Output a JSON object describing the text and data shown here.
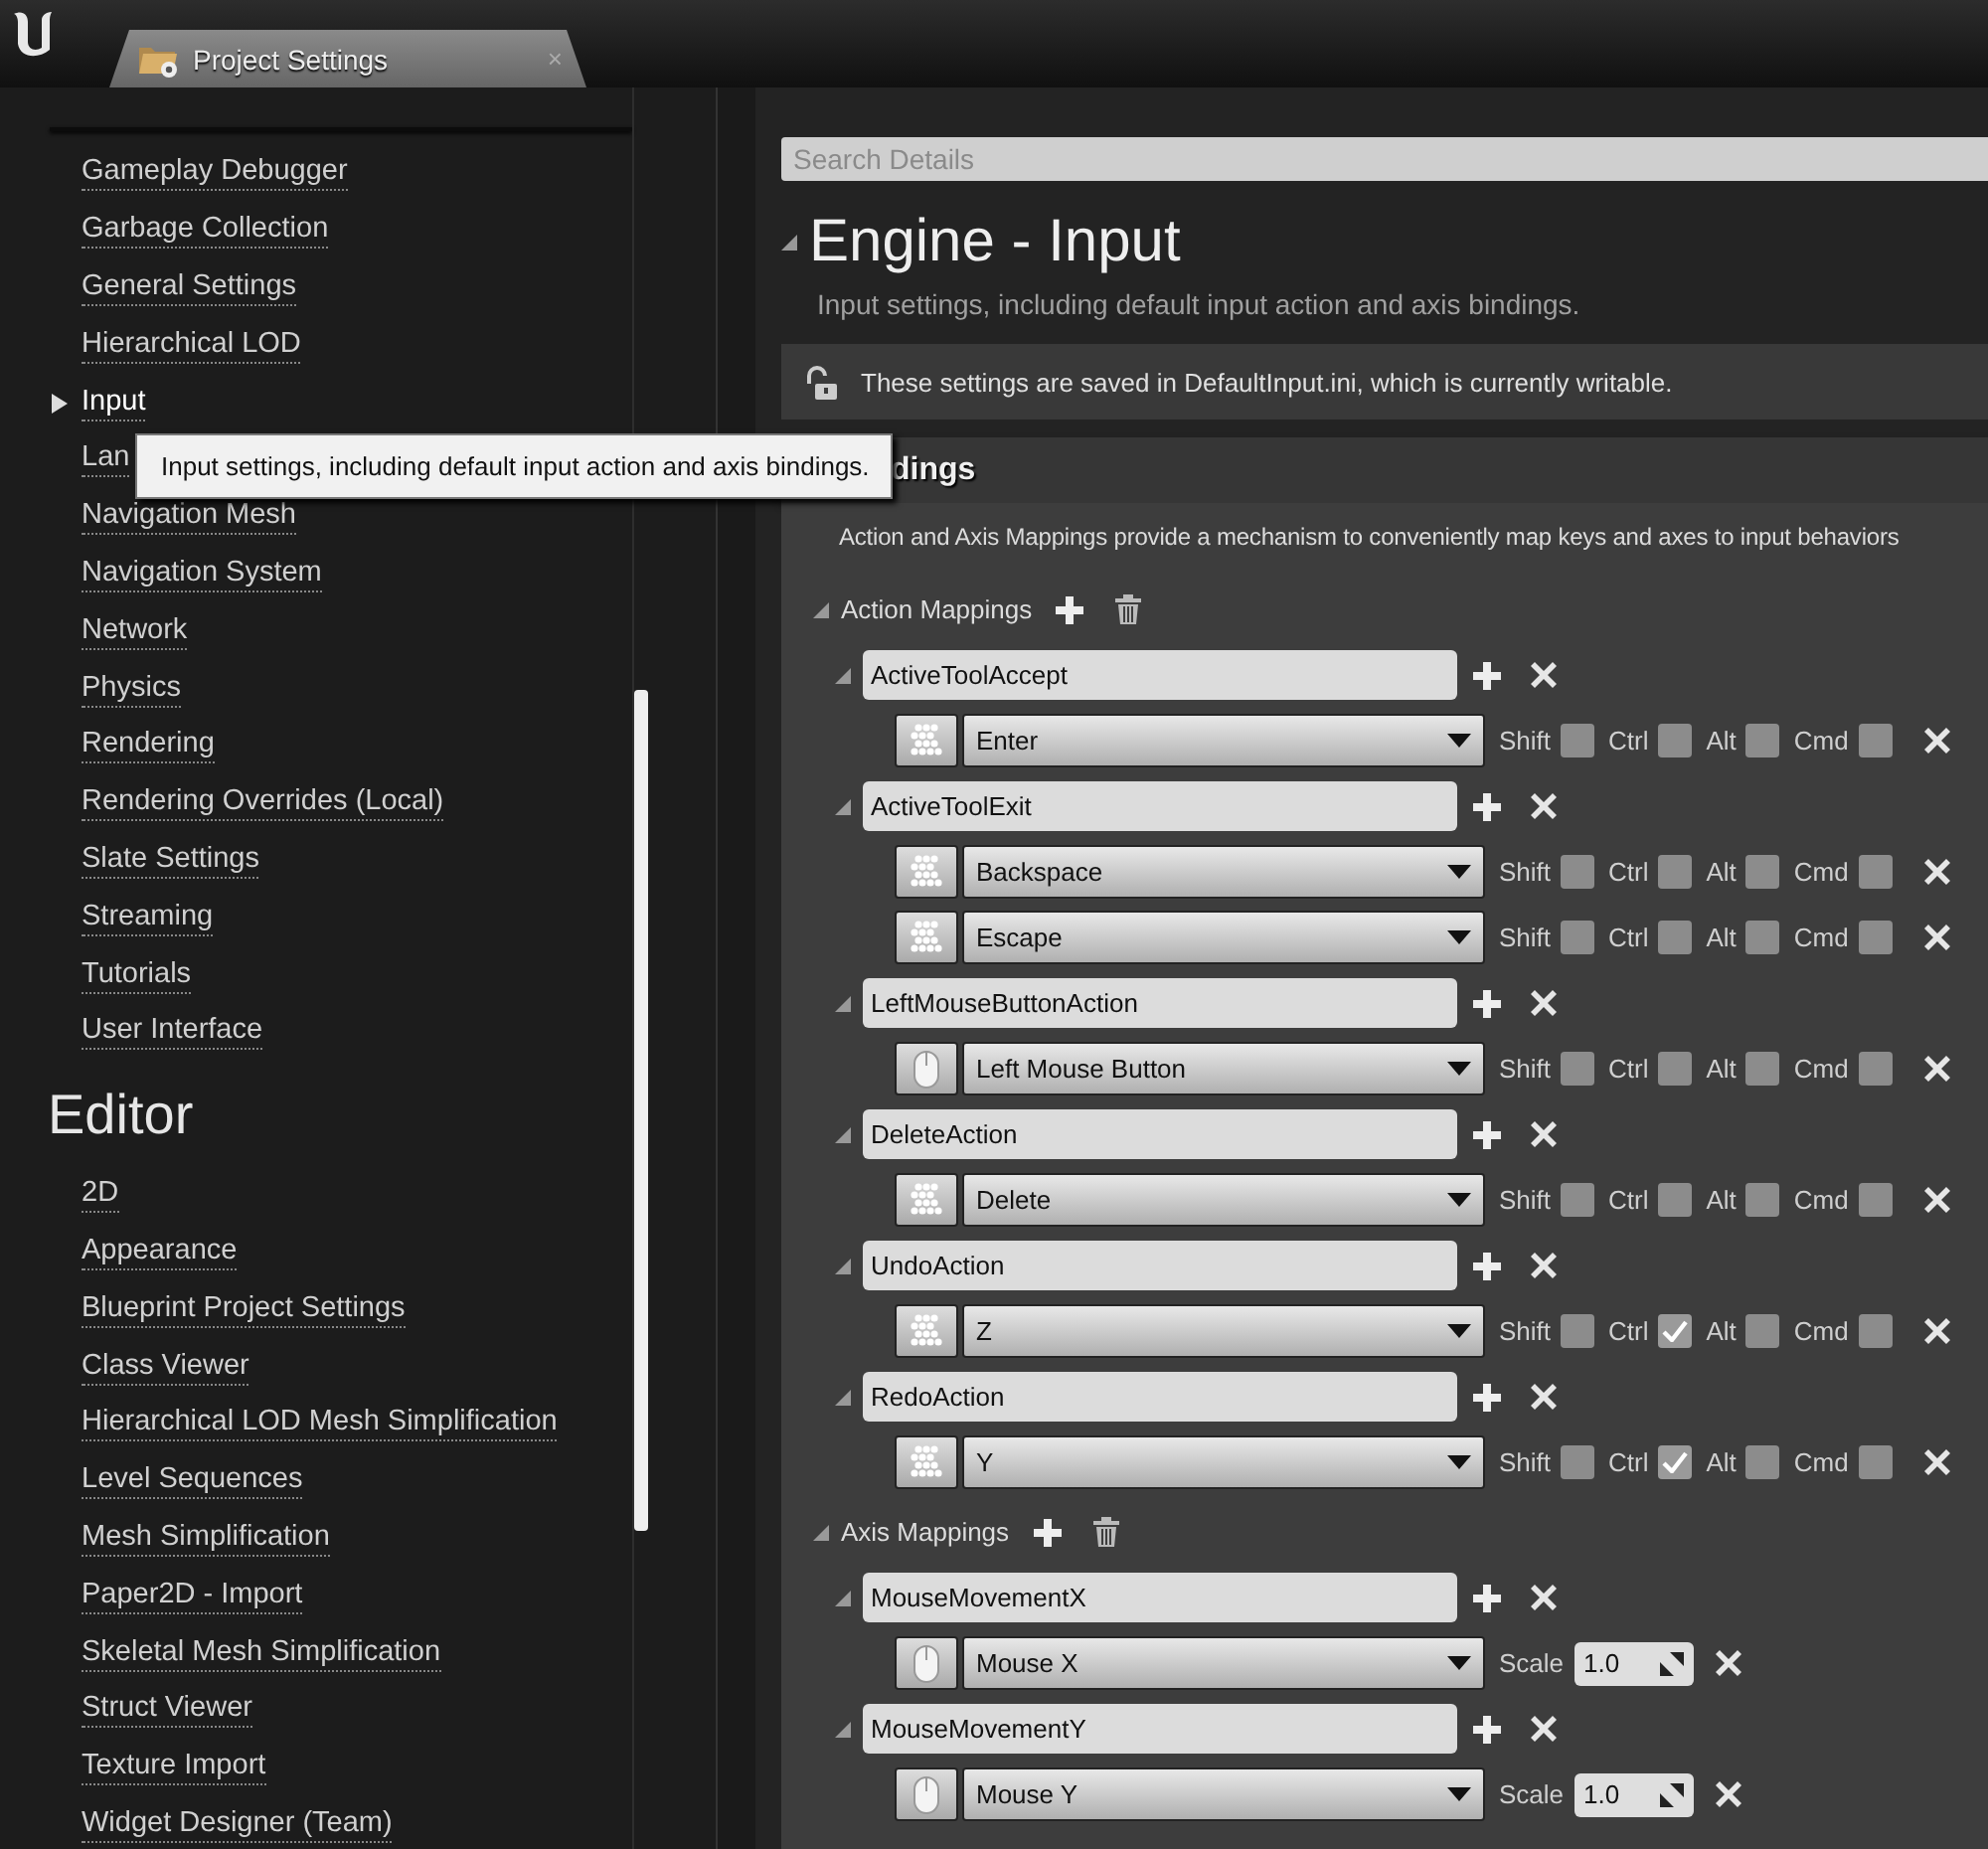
{
  "titlebar": {
    "tab": {
      "title": "Project Settings",
      "close": "×"
    }
  },
  "sidebar": {
    "sections": [
      {
        "items": [
          {
            "label": "Gameplay Debugger",
            "selected": false
          },
          {
            "label": "Garbage Collection",
            "selected": false
          },
          {
            "label": "General Settings",
            "selected": false
          },
          {
            "label": "Hierarchical LOD",
            "selected": false
          },
          {
            "label": "Input",
            "selected": true
          },
          {
            "label": "Lan",
            "selected": false
          },
          {
            "label": "Navigation Mesh",
            "selected": false
          },
          {
            "label": "Navigation System",
            "selected": false
          },
          {
            "label": "Network",
            "selected": false
          },
          {
            "label": "Physics",
            "selected": false
          },
          {
            "label": "Rendering",
            "selected": false
          },
          {
            "label": "Rendering Overrides (Local)",
            "selected": false
          },
          {
            "label": "Slate Settings",
            "selected": false
          },
          {
            "label": "Streaming",
            "selected": false
          },
          {
            "label": "Tutorials",
            "selected": false
          },
          {
            "label": "User Interface",
            "selected": false
          }
        ]
      },
      {
        "title": "Editor",
        "items": [
          {
            "label": "2D",
            "selected": false
          },
          {
            "label": "Appearance",
            "selected": false
          },
          {
            "label": "Blueprint Project Settings",
            "selected": false
          },
          {
            "label": "Class Viewer",
            "selected": false
          },
          {
            "label": "Hierarchical LOD Mesh Simplification",
            "selected": false
          },
          {
            "label": "Level Sequences",
            "selected": false
          },
          {
            "label": "Mesh Simplification",
            "selected": false
          },
          {
            "label": "Paper2D - Import",
            "selected": false
          },
          {
            "label": "Skeletal Mesh Simplification",
            "selected": false
          },
          {
            "label": "Struct Viewer",
            "selected": false
          },
          {
            "label": "Texture Import",
            "selected": false
          },
          {
            "label": "Widget Designer (Team)",
            "selected": false
          }
        ]
      }
    ]
  },
  "tooltip": {
    "text": "Input settings, including default input action and axis bindings."
  },
  "details": {
    "search": {
      "placeholder": "Search Details"
    },
    "title": "Engine - Input",
    "description": "Input settings, including default input action and axis bindings.",
    "banner": {
      "text": "These settings are saved in DefaultInput.ini, which is currently writable."
    },
    "section": {
      "title": "dings",
      "description": "Action and Axis Mappings provide a mechanism to conveniently map keys and axes to input behaviors",
      "groups": [
        {
          "label": "Action Mappings",
          "kind": "action",
          "mappings": [
            {
              "name": "ActiveToolAccept",
              "keys": [
                {
                  "key": "Enter",
                  "kind": "keyboard",
                  "modifiers": [
                    {
                      "label": "Shift",
                      "checked": false
                    },
                    {
                      "label": "Ctrl",
                      "checked": false
                    },
                    {
                      "label": "Alt",
                      "checked": false
                    },
                    {
                      "label": "Cmd",
                      "checked": false
                    }
                  ]
                }
              ]
            },
            {
              "name": "ActiveToolExit",
              "keys": [
                {
                  "key": "Backspace",
                  "kind": "keyboard",
                  "modifiers": [
                    {
                      "label": "Shift",
                      "checked": false
                    },
                    {
                      "label": "Ctrl",
                      "checked": false
                    },
                    {
                      "label": "Alt",
                      "checked": false
                    },
                    {
                      "label": "Cmd",
                      "checked": false
                    }
                  ]
                },
                {
                  "key": "Escape",
                  "kind": "keyboard",
                  "modifiers": [
                    {
                      "label": "Shift",
                      "checked": false
                    },
                    {
                      "label": "Ctrl",
                      "checked": false
                    },
                    {
                      "label": "Alt",
                      "checked": false
                    },
                    {
                      "label": "Cmd",
                      "checked": false
                    }
                  ]
                }
              ]
            },
            {
              "name": "LeftMouseButtonAction",
              "keys": [
                {
                  "key": "Left Mouse Button",
                  "kind": "mouse",
                  "modifiers": [
                    {
                      "label": "Shift",
                      "checked": false
                    },
                    {
                      "label": "Ctrl",
                      "checked": false
                    },
                    {
                      "label": "Alt",
                      "checked": false
                    },
                    {
                      "label": "Cmd",
                      "checked": false
                    }
                  ]
                }
              ]
            },
            {
              "name": "DeleteAction",
              "keys": [
                {
                  "key": "Delete",
                  "kind": "keyboard",
                  "modifiers": [
                    {
                      "label": "Shift",
                      "checked": false
                    },
                    {
                      "label": "Ctrl",
                      "checked": false
                    },
                    {
                      "label": "Alt",
                      "checked": false
                    },
                    {
                      "label": "Cmd",
                      "checked": false
                    }
                  ]
                }
              ]
            },
            {
              "name": "UndoAction",
              "keys": [
                {
                  "key": "Z",
                  "kind": "keyboard",
                  "modifiers": [
                    {
                      "label": "Shift",
                      "checked": false
                    },
                    {
                      "label": "Ctrl",
                      "checked": true
                    },
                    {
                      "label": "Alt",
                      "checked": false
                    },
                    {
                      "label": "Cmd",
                      "checked": false
                    }
                  ]
                }
              ]
            },
            {
              "name": "RedoAction",
              "keys": [
                {
                  "key": "Y",
                  "kind": "keyboard",
                  "modifiers": [
                    {
                      "label": "Shift",
                      "checked": false
                    },
                    {
                      "label": "Ctrl",
                      "checked": true
                    },
                    {
                      "label": "Alt",
                      "checked": false
                    },
                    {
                      "label": "Cmd",
                      "checked": false
                    }
                  ]
                }
              ]
            }
          ]
        },
        {
          "label": "Axis Mappings",
          "kind": "axis",
          "mappings": [
            {
              "name": "MouseMovementX",
              "keys": [
                {
                  "key": "Mouse X",
                  "kind": "mouse",
                  "scale_label": "Scale",
                  "scale": "1.0"
                }
              ]
            },
            {
              "name": "MouseMovementY",
              "keys": [
                {
                  "key": "Mouse Y",
                  "kind": "mouse",
                  "scale_label": "Scale",
                  "scale": "1.0"
                }
              ]
            }
          ]
        }
      ]
    }
  }
}
